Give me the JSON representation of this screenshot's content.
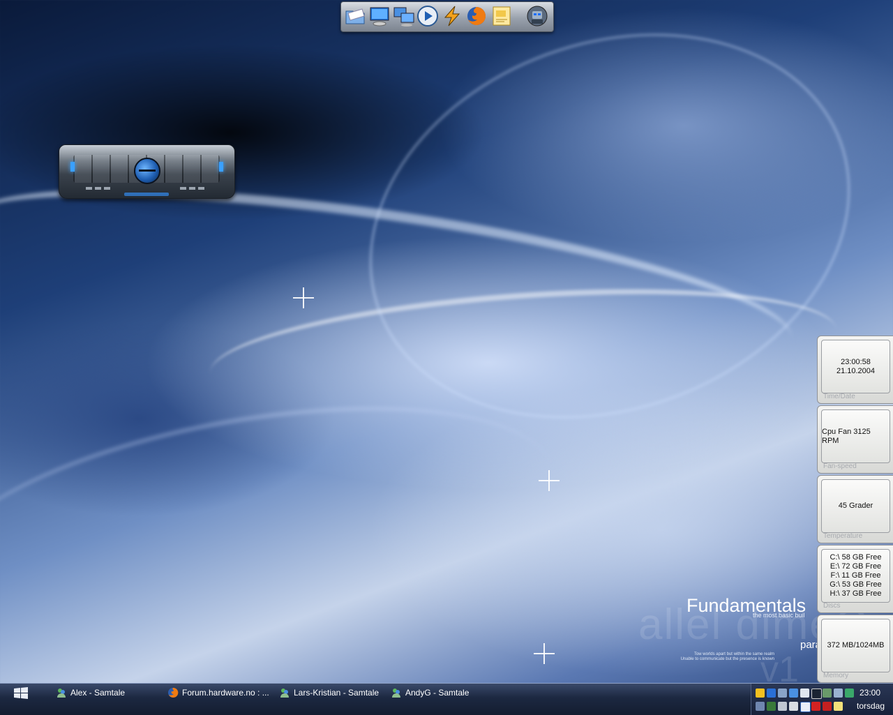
{
  "wallpaper": {
    "watermark_big": "allel dimeG",
    "title": "Fundamentals",
    "subtitle": "the most basic buil",
    "para": "para",
    "line1": "Tow worlds apart but within the same realm",
    "line2": "Unable to communicate but the presence is known",
    "version": "v1"
  },
  "dock": {
    "icons": [
      "folder-icon",
      "monitor-icon",
      "network-icon",
      "media-player-icon",
      "winamp-icon",
      "firefox-icon",
      "notes-icon",
      "robot-icon"
    ]
  },
  "sidebar": {
    "time": "23:00:58",
    "date": "21.10.2004",
    "time_label": "Time/Date",
    "fan": "Cpu Fan 3125 RPM",
    "fan_label": "Fan-speed",
    "temp": "45 Grader",
    "temp_label": "Temperature",
    "discs": [
      "C:\\ 58 GB Free",
      "E:\\ 72 GB Free",
      "F:\\ 11 GB Free",
      "G:\\ 53 GB Free",
      "H:\\ 37 GB Free"
    ],
    "discs_label": "Discs",
    "memory": "372 MB/1024MB",
    "memory_label": "Memory"
  },
  "taskbar": {
    "tasks": [
      {
        "label": "Alex - Samtale",
        "icon": "msn-icon"
      },
      {
        "label": "Forum.hardware.no : ...",
        "icon": "firefox-icon"
      },
      {
        "label": "Lars-Kristian - Samtale",
        "icon": "msn-icon"
      },
      {
        "label": "AndyG - Samtale",
        "icon": "msn-icon"
      }
    ],
    "clock": "23:00",
    "day": "torsdag"
  },
  "colors": {
    "taskbar": "#1c2841",
    "panel": "#e8e9e6",
    "accent": "#3aa0ff"
  }
}
